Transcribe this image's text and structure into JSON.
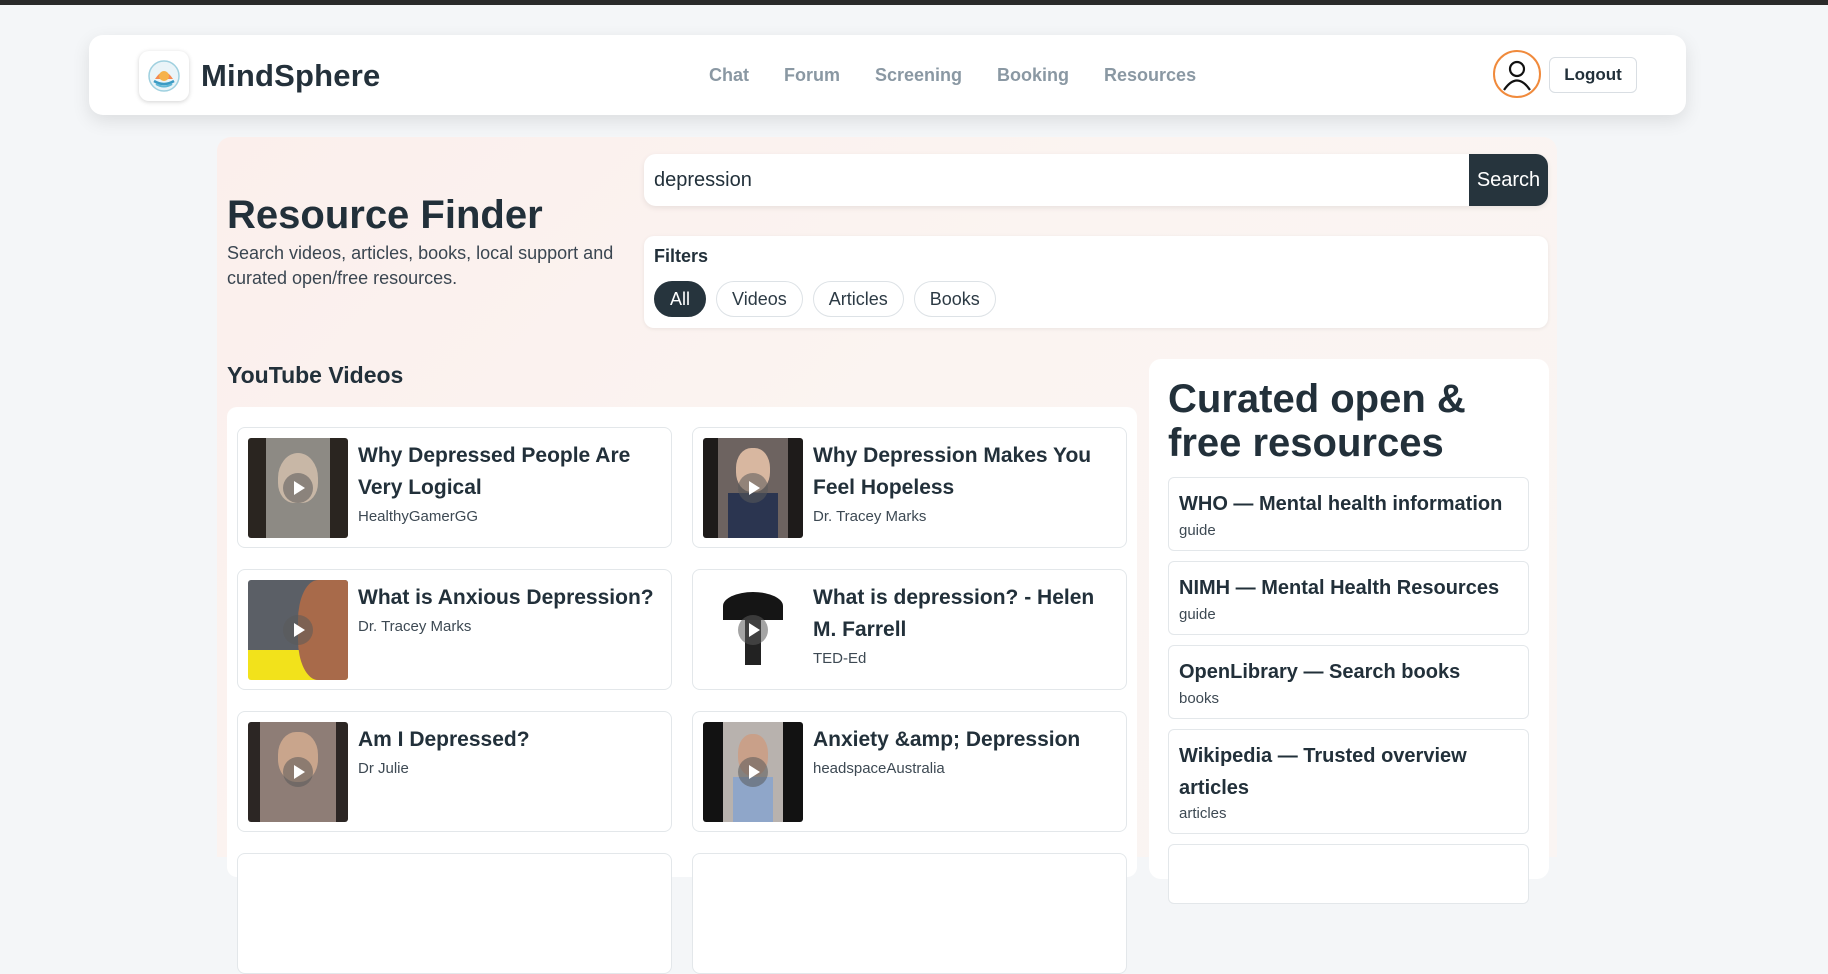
{
  "header": {
    "brand_name": "MindSphere",
    "nav": [
      {
        "label": "Chat"
      },
      {
        "label": "Forum"
      },
      {
        "label": "Screening"
      },
      {
        "label": "Booking"
      },
      {
        "label": "Resources"
      }
    ],
    "logout_label": "Logout"
  },
  "hero": {
    "title": "Resource Finder",
    "subtitle": "Search videos, articles, books, local support and curated open/free resources."
  },
  "search": {
    "value": "depression",
    "button_label": "Search"
  },
  "filters": {
    "label": "Filters",
    "options": [
      {
        "label": "All",
        "active": true
      },
      {
        "label": "Videos",
        "active": false
      },
      {
        "label": "Articles",
        "active": false
      },
      {
        "label": "Books",
        "active": false
      }
    ]
  },
  "videos": {
    "section_title": "YouTube Videos",
    "items": [
      {
        "title": "Why Depressed People Are Very Logical",
        "channel": "HealthyGamerGG"
      },
      {
        "title": "Why Depression Makes You Feel Hopeless",
        "channel": "Dr. Tracey Marks"
      },
      {
        "title": "What is Anxious Depression?",
        "channel": "Dr. Tracey Marks"
      },
      {
        "title": "What is depression? - Helen M. Farrell",
        "channel": "TED-Ed"
      },
      {
        "title": "Am I Depressed?",
        "channel": "Dr Julie"
      },
      {
        "title": "Anxiety &amp; Depression",
        "channel": "headspaceAustralia"
      }
    ]
  },
  "curated": {
    "title": "Curated open & free resources",
    "items": [
      {
        "title": "WHO — Mental health information",
        "tag": "guide"
      },
      {
        "title": "NIMH — Mental Health Resources",
        "tag": "guide"
      },
      {
        "title": "OpenLibrary — Search books",
        "tag": "books"
      },
      {
        "title": "Wikipedia — Trusted overview articles",
        "tag": "articles"
      }
    ]
  },
  "colors": {
    "primary_dark": "#26343d",
    "avatar_ring": "#f08a3c",
    "nav_text": "#8a98a3",
    "panel_tint": "#fbefec"
  },
  "icons": {
    "logo": "brain-sun-logo-icon",
    "avatar": "user-icon",
    "play": "play-icon"
  }
}
